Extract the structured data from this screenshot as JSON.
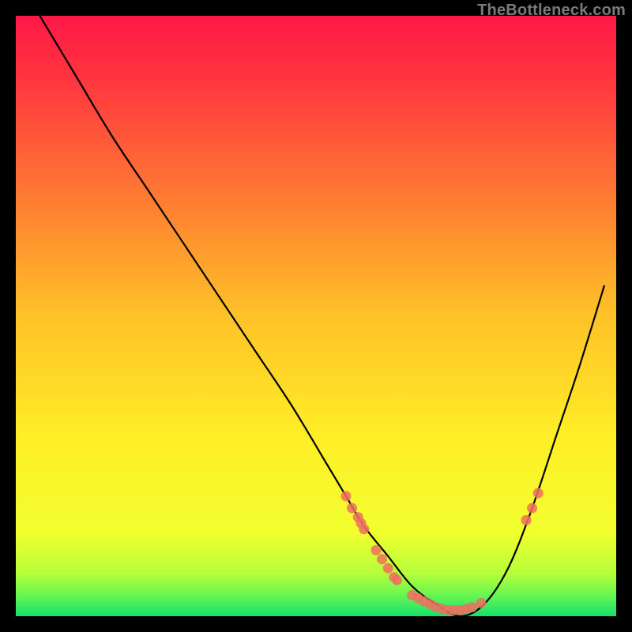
{
  "watermark": "TheBottleneck.com",
  "chart_data": {
    "type": "line",
    "title": "",
    "xlabel": "",
    "ylabel": "",
    "xlim": [
      0,
      100
    ],
    "ylim": [
      0,
      100
    ],
    "grid": false,
    "legend": false,
    "background_gradient": {
      "top": "#ff1846",
      "middle": "#ffe228",
      "bottom": "#14e06e"
    },
    "series": [
      {
        "name": "bottleneck-curve",
        "x": [
          4,
          10,
          16,
          22,
          28,
          34,
          40,
          46,
          52,
          55,
          58,
          62,
          66,
          70,
          74,
          78,
          82,
          86,
          90,
          94,
          98
        ],
        "y": [
          100,
          90,
          80,
          71,
          62,
          53,
          44,
          35,
          25,
          20,
          15,
          10,
          5,
          2,
          0,
          2,
          8,
          18,
          30,
          42,
          55
        ],
        "color": "#000000"
      }
    ],
    "marker_groups": [
      {
        "name": "left-falling-cluster",
        "color": "#ee6e62",
        "points": [
          {
            "x": 55,
            "y": 20
          },
          {
            "x": 56,
            "y": 18
          },
          {
            "x": 57,
            "y": 16.5
          },
          {
            "x": 57.5,
            "y": 15.5
          },
          {
            "x": 58,
            "y": 14.5
          },
          {
            "x": 60,
            "y": 11
          },
          {
            "x": 61,
            "y": 9.5
          },
          {
            "x": 62,
            "y": 8
          },
          {
            "x": 63,
            "y": 6.5
          },
          {
            "x": 63.5,
            "y": 6
          }
        ]
      },
      {
        "name": "bottom-trough-cluster",
        "color": "#ee6e62",
        "points": [
          {
            "x": 66,
            "y": 3.5
          },
          {
            "x": 67,
            "y": 3
          },
          {
            "x": 68,
            "y": 2.5
          },
          {
            "x": 69,
            "y": 2
          },
          {
            "x": 70,
            "y": 1.5
          },
          {
            "x": 71,
            "y": 1.2
          },
          {
            "x": 72,
            "y": 1
          },
          {
            "x": 73,
            "y": 1
          },
          {
            "x": 74,
            "y": 1
          },
          {
            "x": 75,
            "y": 1.2
          },
          {
            "x": 76,
            "y": 1.5
          },
          {
            "x": 77.5,
            "y": 2.2
          }
        ]
      },
      {
        "name": "right-rising-cluster",
        "color": "#ee6e62",
        "points": [
          {
            "x": 85,
            "y": 16
          },
          {
            "x": 86,
            "y": 18
          },
          {
            "x": 87,
            "y": 20.5
          }
        ]
      }
    ]
  }
}
